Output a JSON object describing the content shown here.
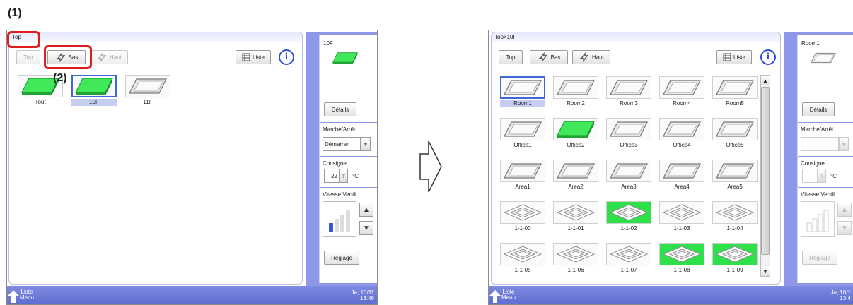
{
  "annotations": {
    "step1": "(1)",
    "step2": "(2)"
  },
  "colors": {
    "accent": "#8f98e8",
    "selected_border": "#3f67d8",
    "on_green": "#2ee04a",
    "highlight": "#e01e1e"
  },
  "left": {
    "breadcrumb": "Top",
    "toolbar": {
      "top": "Top",
      "bas": "Bas",
      "haut": "Haut",
      "liste": "Liste"
    },
    "tiles": [
      "Tout",
      "10F",
      "11F"
    ],
    "side": {
      "title": "10F",
      "details": "Détails",
      "onoff_label": "Marche/Arrêt",
      "onoff_value": "Démarrer",
      "setpoint_label": "Consigne",
      "setpoint_value": "22",
      "unit": "°C",
      "fan_label": "Vitesse Ventil",
      "adjust": "Réglage"
    },
    "footer": {
      "menu_line1": "Liste",
      "menu_line2": "Menu",
      "date": "Je, 10/11",
      "time": "13:46"
    }
  },
  "right": {
    "breadcrumb": "Top>10F",
    "toolbar": {
      "top": "Top",
      "bas": "Bas",
      "haut": "Haut",
      "liste": "Liste"
    },
    "rooms": [
      "Room1",
      "Room2",
      "Room3",
      "Room4",
      "Room5"
    ],
    "offices": [
      "Office1",
      "Office2",
      "Office3",
      "Office4",
      "Office5"
    ],
    "areas": [
      "Area1",
      "Area2",
      "Area3",
      "Area4",
      "Area5"
    ],
    "units_row1": [
      "1-1-00",
      "1-1-01",
      "1-1-02",
      "1-1-03",
      "1-1-04"
    ],
    "units_row2": [
      "1-1-05",
      "1-1-06",
      "1-1-07",
      "1-1-08",
      "1-1-09"
    ],
    "side": {
      "title": "Room1",
      "details": "Détails",
      "onoff_label": "Marche/Arrêt",
      "setpoint_label": "Consigne",
      "unit": "°C",
      "fan_label": "Vitesse Ventil",
      "adjust": "Réglage"
    },
    "footer": {
      "menu_line1": "Liste",
      "menu_line2": "Menu",
      "date": "Je, 10/1",
      "time": "13:4"
    }
  }
}
